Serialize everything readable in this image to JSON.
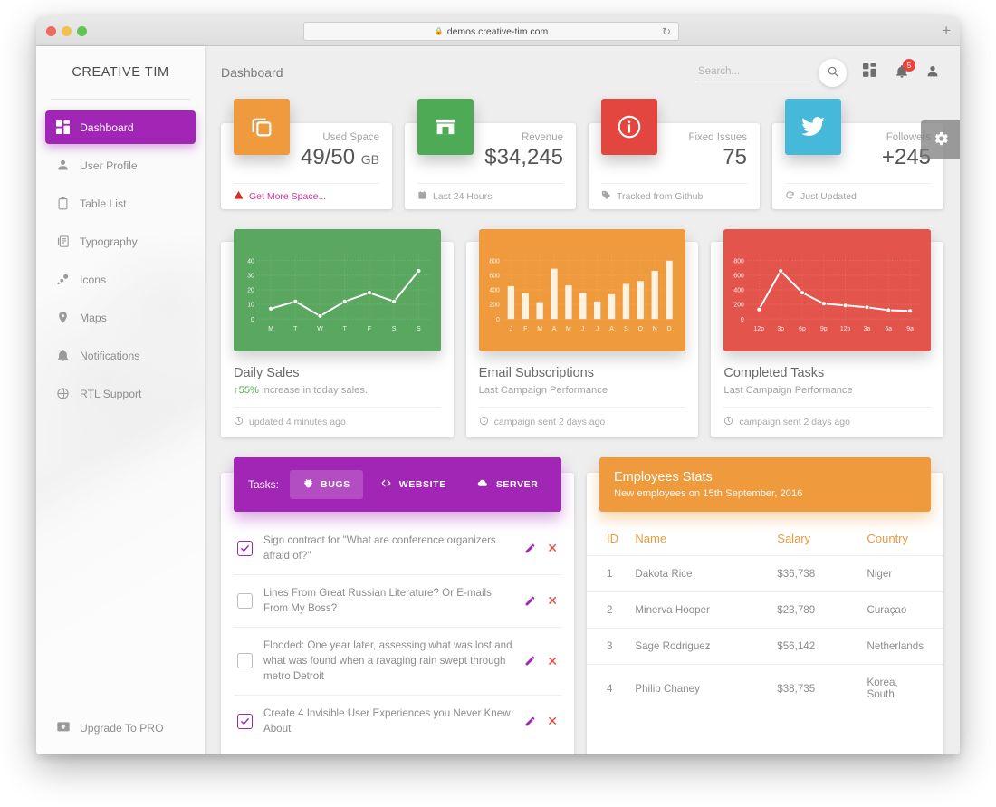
{
  "browser": {
    "url": "demos.creative-tim.com",
    "lock_icon": "lock-icon",
    "reload_icon": "reload-icon",
    "newtab_icon": "plus-icon"
  },
  "sidebar": {
    "brand": "CREATIVE TIM",
    "items": [
      {
        "label": "Dashboard",
        "icon": "dashboard-icon",
        "active": true
      },
      {
        "label": "User Profile",
        "icon": "person-icon",
        "active": false
      },
      {
        "label": "Table List",
        "icon": "clipboard-icon",
        "active": false
      },
      {
        "label": "Typography",
        "icon": "typography-icon",
        "active": false
      },
      {
        "label": "Icons",
        "icon": "bubble-icon",
        "active": false
      },
      {
        "label": "Maps",
        "icon": "map-pin-icon",
        "active": false
      },
      {
        "label": "Notifications",
        "icon": "bell-icon",
        "active": false
      },
      {
        "label": "RTL Support",
        "icon": "globe-icon",
        "active": false
      }
    ],
    "upgrade_label": "Upgrade To PRO",
    "upgrade_icon": "unarchive-icon",
    "active_color": "#a126b5"
  },
  "topnav": {
    "page_title": "Dashboard",
    "search_placeholder": "Search...",
    "search_value": "",
    "search_icon": "search-icon",
    "apps_icon": "apps-grid-icon",
    "bell_icon": "bell-icon",
    "notification_count": "5",
    "notification_color": "#e8433c",
    "person_icon": "person-icon"
  },
  "settings_fab": {
    "icon": "gear-icon",
    "label": "Settings"
  },
  "stats": [
    {
      "icon": "copy-icon",
      "color": "#ef9a3d",
      "label": "Used Space",
      "value": "49/50",
      "unit": "GB",
      "foot": "Get More Space...",
      "foot_icon": "warning-icon",
      "foot_warn": true
    },
    {
      "icon": "store-icon",
      "color": "#4eaa54",
      "label": "Revenue",
      "value": "$34,245",
      "unit": "",
      "foot": "Last 24 Hours",
      "foot_icon": "calendar-icon",
      "foot_warn": false
    },
    {
      "icon": "info-icon",
      "color": "#e3453f",
      "label": "Fixed Issues",
      "value": "75",
      "unit": "",
      "foot": "Tracked from Github",
      "foot_icon": "tag-icon",
      "foot_warn": false
    },
    {
      "icon": "twitter-icon",
      "color": "#46b8da",
      "label": "Followers",
      "value": "+245",
      "unit": "",
      "foot": "Just Updated",
      "foot_icon": "refresh-icon",
      "foot_warn": false
    }
  ],
  "chart_cards": [
    {
      "title": "Daily Sales",
      "subtitle_prefix": "55%",
      "subtitle": " increase in today sales.",
      "subtitle_icon": "arrow-up-icon",
      "foot": "updated 4 minutes ago",
      "foot_icon": "clock-icon",
      "bg": "#5aa75f"
    },
    {
      "title": "Email Subscriptions",
      "subtitle_prefix": "",
      "subtitle": "Last Campaign Performance",
      "subtitle_icon": "",
      "foot": "campaign sent 2 days ago",
      "foot_icon": "clock-icon",
      "bg": "#ef9a3d"
    },
    {
      "title": "Completed Tasks",
      "subtitle_prefix": "",
      "subtitle": "Last Campaign Performance",
      "subtitle_icon": "",
      "foot": "campaign sent 2 days ago",
      "foot_icon": "clock-icon",
      "bg": "#e3544c"
    }
  ],
  "chart_data": [
    {
      "type": "line",
      "title": "Daily Sales",
      "xlabel": "",
      "ylabel": "",
      "categories": [
        "M",
        "T",
        "W",
        "T",
        "F",
        "S",
        "S"
      ],
      "values": [
        7,
        12,
        2,
        12,
        18,
        12,
        33
      ],
      "yticks": [
        0,
        10,
        20,
        30,
        40
      ],
      "ylim": [
        0,
        45
      ],
      "grid": true,
      "legend": "none",
      "series_color": "#ffffff",
      "plot_bg": "#5aa75f"
    },
    {
      "type": "bar",
      "title": "Email Subscriptions",
      "xlabel": "",
      "ylabel": "",
      "categories": [
        "J",
        "F",
        "M",
        "A",
        "M",
        "J",
        "J",
        "A",
        "S",
        "O",
        "N",
        "D"
      ],
      "values": [
        450,
        350,
        230,
        690,
        460,
        360,
        240,
        340,
        480,
        520,
        660,
        800
      ],
      "yticks": [
        0,
        200,
        400,
        600,
        800
      ],
      "ylim": [
        0,
        900
      ],
      "grid": true,
      "legend": "none",
      "series_color": "#fdf3e0",
      "plot_bg": "#ef9a3d"
    },
    {
      "type": "line",
      "title": "Completed Tasks",
      "xlabel": "",
      "ylabel": "",
      "categories": [
        "12p",
        "3p",
        "6p",
        "9p",
        "12p",
        "3a",
        "6a",
        "9a"
      ],
      "values": [
        130,
        660,
        360,
        210,
        185,
        160,
        120,
        110
      ],
      "yticks": [
        0,
        200,
        400,
        600,
        800
      ],
      "ylim": [
        0,
        900
      ],
      "grid": true,
      "legend": "none",
      "series_color": "#ffffff",
      "plot_bg": "#e3544c"
    }
  ],
  "tasks_panel": {
    "label": "Tasks:",
    "tabs": [
      {
        "label": "BUGS",
        "icon": "bug-icon",
        "active": true
      },
      {
        "label": "WEBSITE",
        "icon": "code-icon",
        "active": false
      },
      {
        "label": "SERVER",
        "icon": "cloud-icon",
        "active": false
      }
    ],
    "edit_icon": "pencil-icon",
    "delete_icon": "close-icon",
    "items": [
      {
        "checked": true,
        "text": "Sign contract for \"What are conference organizers afraid of?\""
      },
      {
        "checked": false,
        "text": "Lines From Great Russian Literature? Or E-mails From My Boss?"
      },
      {
        "checked": false,
        "text": "Flooded: One year later, assessing what was lost and what was found when a ravaging rain swept through metro Detroit"
      },
      {
        "checked": true,
        "text": "Create 4 Invisible User Experiences you Never Knew About"
      }
    ]
  },
  "employees": {
    "title": "Employees Stats",
    "subtitle": "New employees on 15th September, 2016",
    "columns": [
      "ID",
      "Name",
      "Salary",
      "Country"
    ],
    "rows": [
      [
        "1",
        "Dakota Rice",
        "$36,738",
        "Niger"
      ],
      [
        "2",
        "Minerva Hooper",
        "$23,789",
        "Curaçao"
      ],
      [
        "3",
        "Sage Rodriguez",
        "$56,142",
        "Netherlands"
      ],
      [
        "4",
        "Philip Chaney",
        "$38,735",
        "Korea, South"
      ]
    ]
  }
}
